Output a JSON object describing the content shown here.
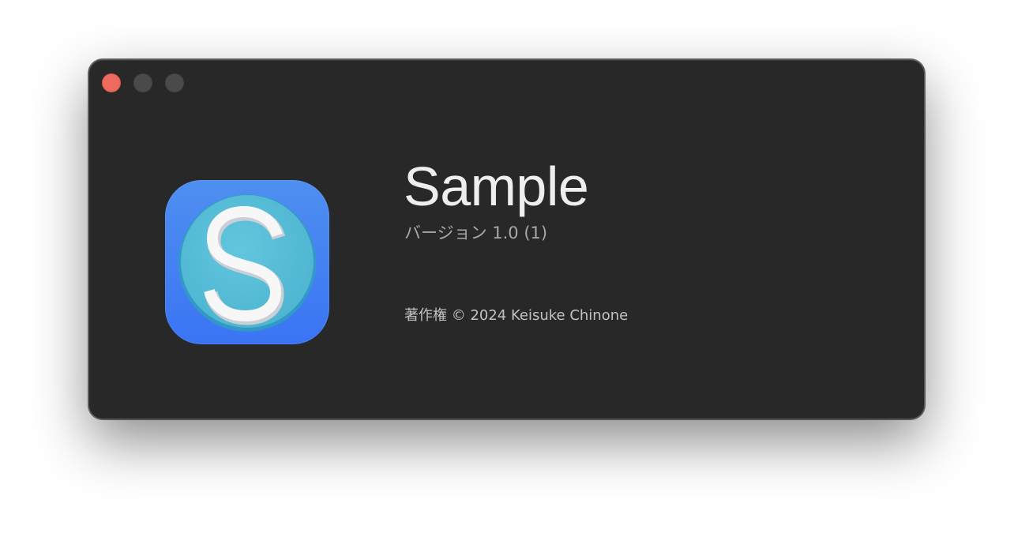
{
  "window": {
    "traffic_lights": {
      "close_color": "#ec6a5e",
      "inactive_color": "#4a4a4a"
    }
  },
  "about": {
    "app_name": "Sample",
    "version": "バージョン 1.0 (1)",
    "copyright": "著作権 © 2024 Keisuke Chinone",
    "icon": {
      "name": "app-icon-s",
      "background_color": "#3f7ef2",
      "circle_color": "#56bcd6"
    }
  }
}
